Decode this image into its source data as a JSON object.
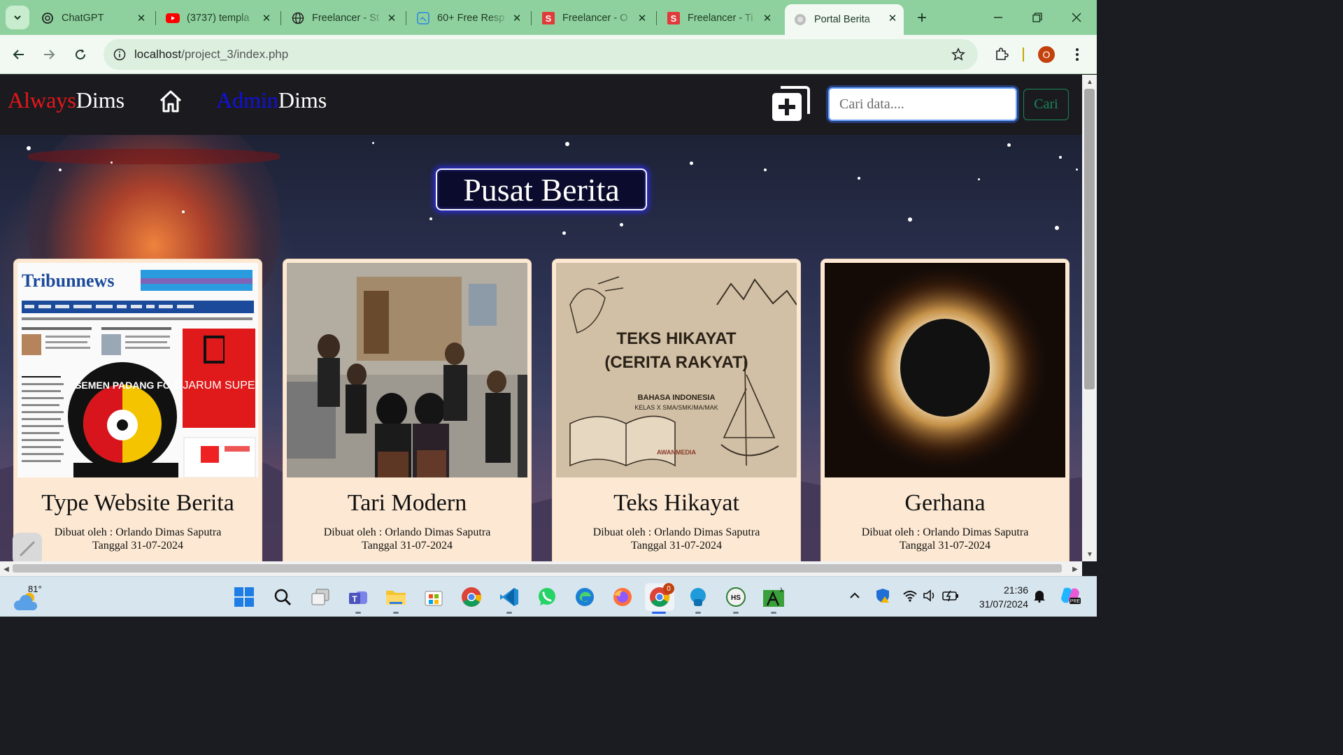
{
  "browser": {
    "tabs": [
      {
        "title": "ChatGPT",
        "icon": "chatgpt-icon"
      },
      {
        "title": "(3737) templa",
        "icon": "youtube-icon"
      },
      {
        "title": "Freelancer - St",
        "icon": "globe-icon"
      },
      {
        "title": "60+ Free Resp",
        "icon": "template-icon"
      },
      {
        "title": "Freelancer - O",
        "icon": "s-icon"
      },
      {
        "title": "Freelancer - Ti",
        "icon": "s-icon"
      },
      {
        "title": "Portal Berita",
        "icon": "globe-icon",
        "active": true
      }
    ],
    "url_host": "localhost",
    "url_path": "/project_3/index.php",
    "profile_initial": "O"
  },
  "navbar": {
    "brand_part1": "Always",
    "brand_part2": "Dims",
    "admin_part1": "Admin",
    "admin_part2": "Dims",
    "search_placeholder": "Cari data....",
    "search_button": "Cari"
  },
  "page": {
    "title": "Pusat Berita",
    "cards": [
      {
        "title": "Type Website Berita",
        "author": "Dibuat oleh : Orlando Dimas Saputra",
        "date": "Tanggal 31-07-2024",
        "thumb_label_1": "Tribunnews",
        "thumb_label_2": "DJARUM SUPER",
        "thumb_label_3": "SEMEN PADANG FC"
      },
      {
        "title": "Tari Modern",
        "author": "Dibuat oleh : Orlando Dimas Saputra",
        "date": "Tanggal 31-07-2024"
      },
      {
        "title": "Teks Hikayat",
        "author": "Dibuat oleh : Orlando Dimas Saputra",
        "date": "Tanggal 31-07-2024",
        "thumb_label_1": "TEKS HIKAYAT",
        "thumb_label_2": "(CERITA RAKYAT)",
        "thumb_label_3": "BAHASA INDONESIA",
        "thumb_label_4": "KELAS X SMA/SMK/MA/MAK",
        "thumb_label_5": "AWANMEDIA"
      },
      {
        "title": "Gerhana",
        "author": "Dibuat oleh : Orlando Dimas Saputra",
        "date": "Tanggal 31-07-2024"
      }
    ]
  },
  "taskbar": {
    "temperature": "81°",
    "time": "21:36",
    "date": "31/07/2024",
    "chrome_badge": "0",
    "apps": [
      "start-icon",
      "search-icon",
      "task-view-icon",
      "teams-icon",
      "file-explorer-icon",
      "store-icon",
      "chrome-icon",
      "vscode-icon",
      "whatsapp-icon",
      "edge-icon",
      "firefox-icon",
      "chrome-profile-icon",
      "onedrive-icon",
      "hs-icon",
      "xampp-icon"
    ]
  }
}
